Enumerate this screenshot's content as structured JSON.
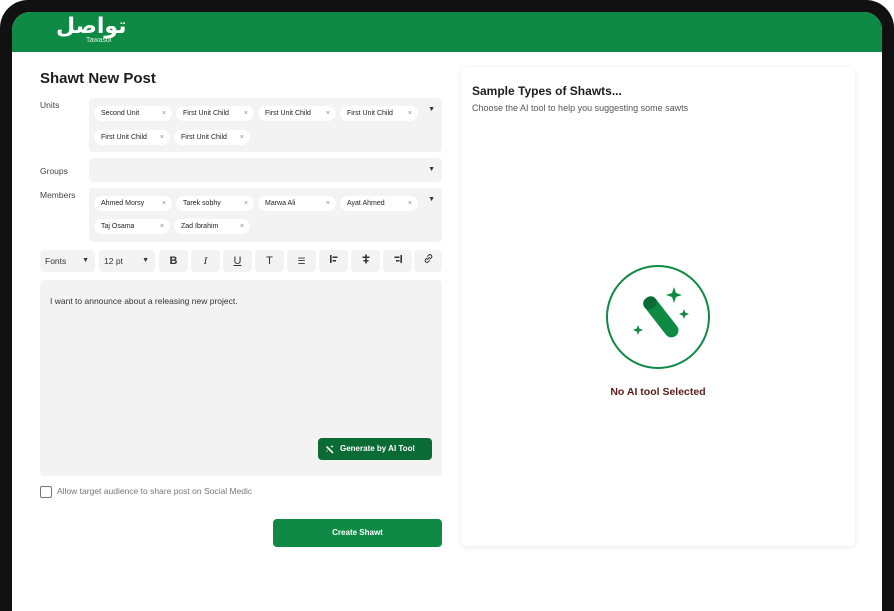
{
  "app": {
    "logo_arabic": "تواصل",
    "logo_english": "Tawasol"
  },
  "form": {
    "title": "Shawt New Post",
    "units_label": "Units",
    "groups_label": "Groups",
    "members_label": "Members",
    "units": [
      "Second Unit",
      "First Unit Child",
      "First Unit Child",
      "First Unit Child",
      "First Unit Child",
      "First Unit Child"
    ],
    "members": [
      "Ahmed Morsy",
      "Tarek sobhy",
      "Marwa Ali",
      "Ayat Ahmed",
      "Taj Osama",
      "Zad Ibrahim"
    ],
    "chip_remove": "×",
    "caret": "▼"
  },
  "toolbar": {
    "font_select": "Fonts",
    "size_select": "12 pt",
    "bold": "B",
    "italic": "I",
    "underline": "U",
    "text": "T",
    "list": "☰",
    "align_left": "⫶",
    "align_center": "≑",
    "align_right": "⫶",
    "link": "🔗"
  },
  "editor": {
    "content": "I want to announce about a releasing new project.",
    "generate_label": "Generate by AI Tool"
  },
  "checkbox": {
    "label": "Allow target audience to share post on Social Medic",
    "checked": false
  },
  "create_label": "Create Shawt",
  "panel": {
    "title": "Sample Types of Shawts...",
    "subtitle": "Choose the AI tool to help you suggesting some sawts",
    "empty_state": "No AI tool Selected"
  },
  "colors": {
    "brand_green": "#0e8a44",
    "dark_green": "#0a6b35",
    "empty_state_text": "#5a1e16"
  },
  "icons": {
    "wand": "magic-wand-icon",
    "link": "link-icon"
  }
}
